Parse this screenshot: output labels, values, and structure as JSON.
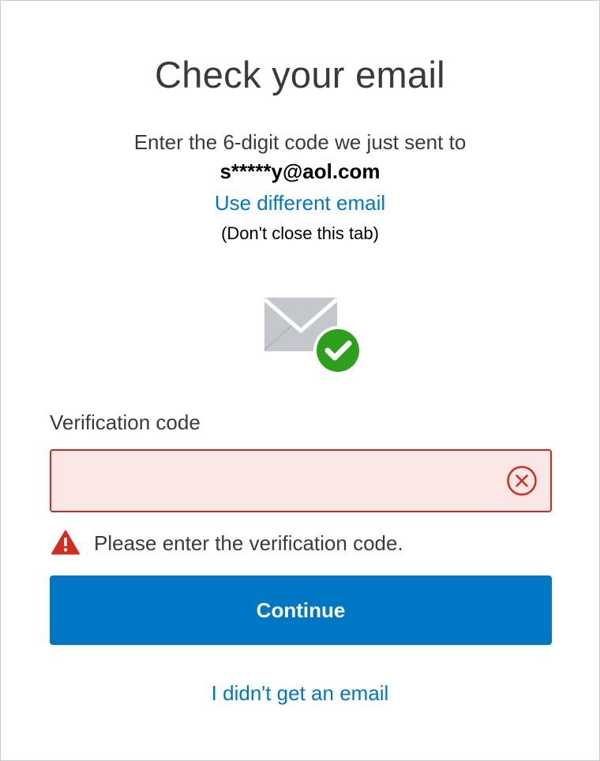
{
  "header": {
    "title": "Check your email",
    "subtitle": "Enter the 6-digit code we just sent to",
    "email": "s*****y@aol.com",
    "use_different_email": "Use different email",
    "note": "(Don't close this tab)"
  },
  "illustration": {
    "icon": "envelope-checkmark-icon",
    "envelope_color": "#c4c7cc",
    "check_color": "#2ca01c"
  },
  "form": {
    "code_label": "Verification code",
    "code_value": "",
    "code_placeholder": "",
    "error_message": "Please enter the verification code.",
    "continue_label": "Continue"
  },
  "footer": {
    "no_email_link": "I didn't get an email"
  },
  "colors": {
    "link": "#0077c5",
    "primary_button": "#0077c5",
    "error": "#d52b1e",
    "error_field_bg": "#fbe8e6",
    "text": "#393a3d"
  }
}
